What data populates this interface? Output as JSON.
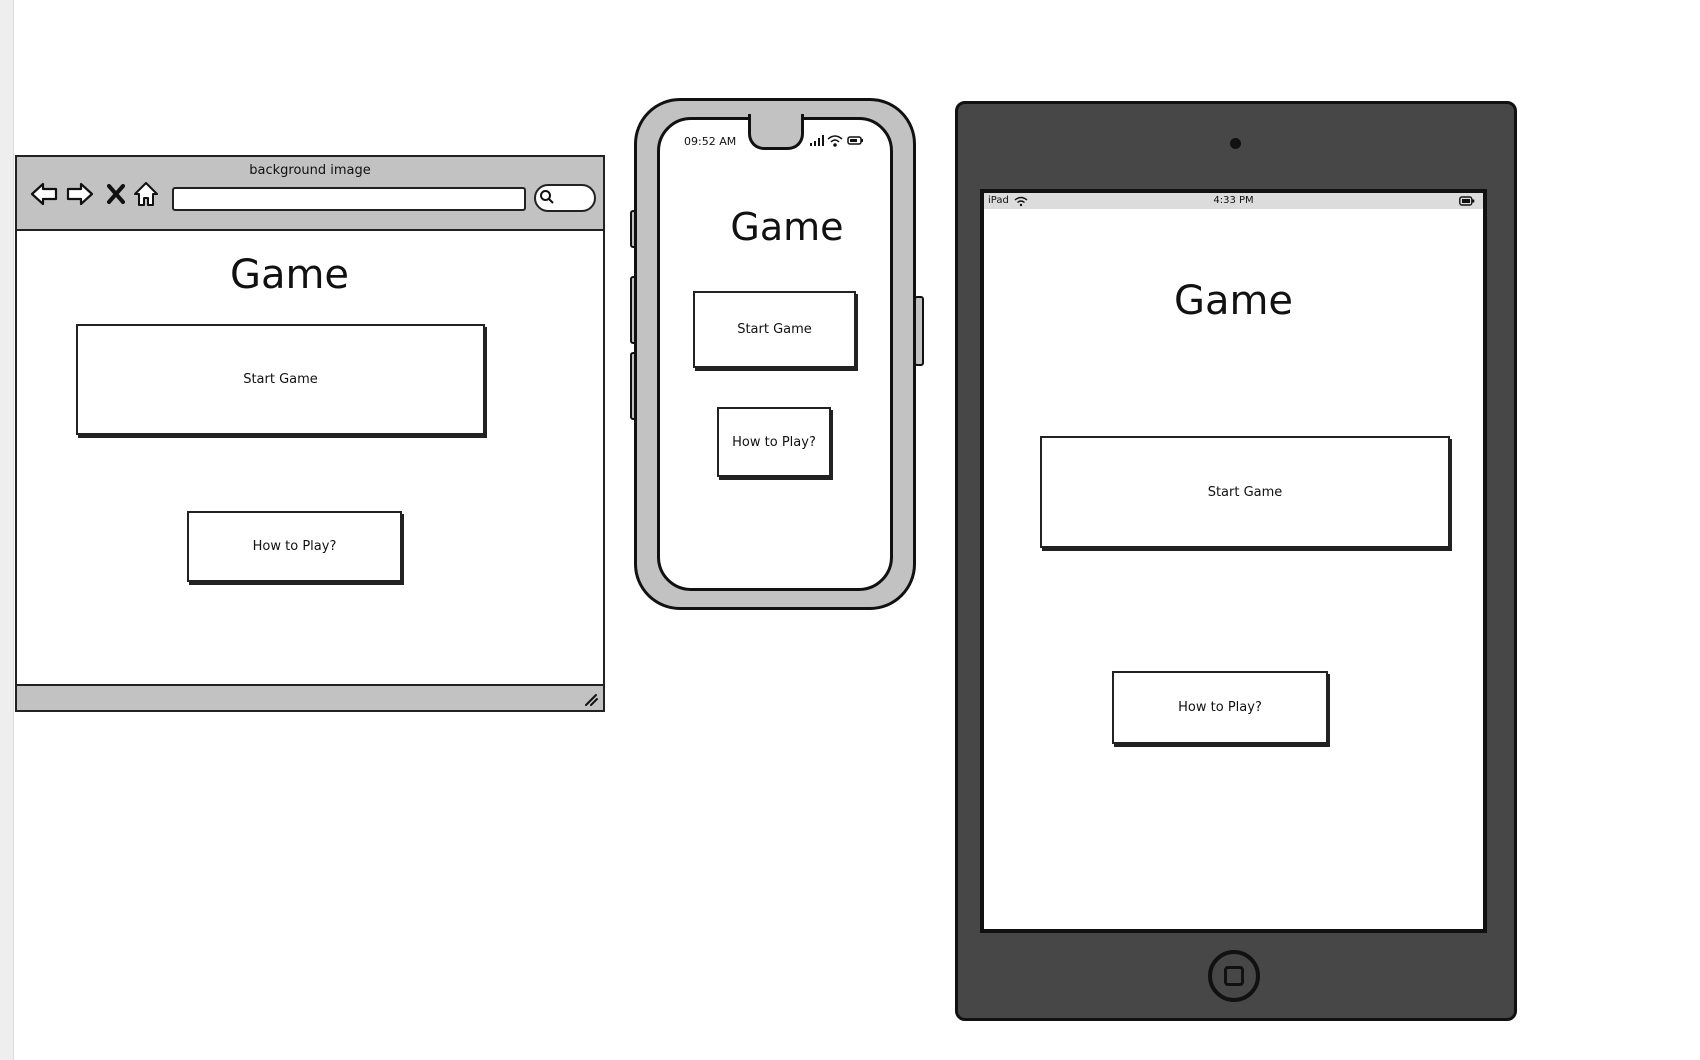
{
  "browser": {
    "title": "background image",
    "heading": "Game",
    "start_label": "Start Game",
    "howto_label": "How to Play?"
  },
  "phone": {
    "time": "09:52 AM",
    "heading": "Game",
    "start_label": "Start Game",
    "howto_label": "How to Play?"
  },
  "tablet": {
    "device": "iPad",
    "time": "4:33 PM",
    "heading": "Game",
    "start_label": "Start Game",
    "howto_label": "How to Play?"
  },
  "colors": {
    "chrome_gray": "#c2c2c2",
    "tablet_body": "#474747",
    "outline": "#111111"
  }
}
